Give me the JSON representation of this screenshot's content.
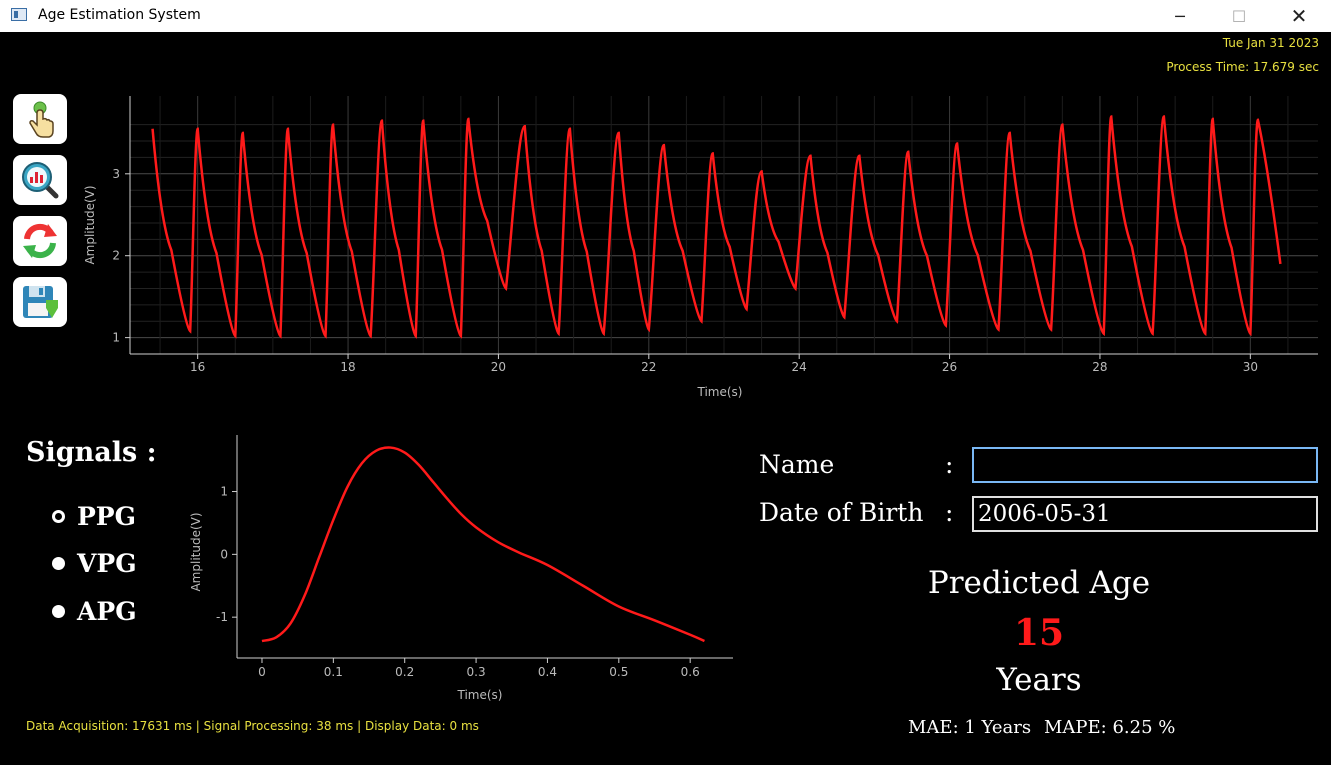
{
  "window": {
    "title": "Age Estimation System",
    "minimize": "─",
    "maximize": "☐",
    "close": "✕"
  },
  "header": {
    "date": "Tue Jan 31 2023",
    "process_time": "Process Time: 17.679 sec"
  },
  "toolbar": [
    {
      "icon": "finger-touch-icon"
    },
    {
      "icon": "analysis-magnifier-icon"
    },
    {
      "icon": "refresh-icon"
    },
    {
      "icon": "save-disk-icon"
    }
  ],
  "signals": {
    "title": "Signals :",
    "options": [
      "PPG",
      "VPG",
      "APG"
    ],
    "selected": "PPG"
  },
  "form": {
    "name_label": "Name",
    "name_colon": ":",
    "name_value": "",
    "dob_label": "Date of Birth",
    "dob_colon": ":",
    "dob_value": "2006-05-31"
  },
  "prediction": {
    "title": "Predicted Age",
    "value": "15",
    "unit": "Years"
  },
  "metrics": {
    "mae": "MAE: 1 Years",
    "mape": "MAPE: 6.25 %"
  },
  "status": "Data Acquisition: 17631 ms | Signal Processing: 38 ms | Display Data: 0 ms",
  "colors": {
    "signal": "#ff1a1a",
    "status_text": "#e8e040",
    "background": "#000000"
  },
  "chart_data": [
    {
      "type": "line",
      "xlabel": "Time(s)",
      "ylabel": "Amplitude(V)",
      "xlim": [
        15.1,
        30.9
      ],
      "ylim": [
        0.8,
        3.95
      ],
      "xticks": [
        "16",
        "18",
        "20",
        "22",
        "24",
        "26",
        "28",
        "30"
      ],
      "yticks": [
        "1",
        "2",
        "3"
      ],
      "grid": true,
      "series": [
        {
          "start": {
            "x": 15.4,
            "y": 3.55
          },
          "cycles": [
            {
              "trough": 15.9,
              "y_trough": 1.08,
              "peak": 16.0,
              "y_peak": 3.55
            },
            {
              "trough": 16.5,
              "y_trough": 1.02,
              "peak": 16.6,
              "y_peak": 3.5
            },
            {
              "trough": 17.1,
              "y_trough": 1.02,
              "peak": 17.2,
              "y_peak": 3.55
            },
            {
              "trough": 17.7,
              "y_trough": 1.02,
              "peak": 17.8,
              "y_peak": 3.6
            },
            {
              "trough": 18.3,
              "y_trough": 1.02,
              "peak": 18.45,
              "y_peak": 3.65
            },
            {
              "trough": 18.9,
              "y_trough": 1.02,
              "peak": 19.0,
              "y_peak": 3.65
            },
            {
              "trough": 19.5,
              "y_trough": 1.02,
              "peak": 19.6,
              "y_peak": 3.67
            },
            {
              "trough": 20.1,
              "y_trough": 1.6,
              "peak": 20.35,
              "y_peak": 3.58
            },
            {
              "trough": 20.8,
              "y_trough": 1.05,
              "peak": 20.95,
              "y_peak": 3.55
            },
            {
              "trough": 21.4,
              "y_trough": 1.05,
              "peak": 21.6,
              "y_peak": 3.5
            },
            {
              "trough": 22.0,
              "y_trough": 1.1,
              "peak": 22.2,
              "y_peak": 3.35
            },
            {
              "trough": 22.7,
              "y_trough": 1.2,
              "peak": 22.85,
              "y_peak": 3.25
            },
            {
              "trough": 23.3,
              "y_trough": 1.35,
              "peak": 23.5,
              "y_peak": 3.03
            },
            {
              "trough": 23.95,
              "y_trough": 1.6,
              "peak": 24.15,
              "y_peak": 3.22
            },
            {
              "trough": 24.6,
              "y_trough": 1.25,
              "peak": 24.8,
              "y_peak": 3.22
            },
            {
              "trough": 25.3,
              "y_trough": 1.2,
              "peak": 25.45,
              "y_peak": 3.27
            },
            {
              "trough": 25.95,
              "y_trough": 1.15,
              "peak": 26.1,
              "y_peak": 3.37
            },
            {
              "trough": 26.65,
              "y_trough": 1.1,
              "peak": 26.8,
              "y_peak": 3.5
            },
            {
              "trough": 27.35,
              "y_trough": 1.1,
              "peak": 27.5,
              "y_peak": 3.6
            },
            {
              "trough": 28.05,
              "y_trough": 1.05,
              "peak": 28.15,
              "y_peak": 3.7
            },
            {
              "trough": 28.7,
              "y_trough": 1.05,
              "peak": 28.85,
              "y_peak": 3.7
            },
            {
              "trough": 29.4,
              "y_trough": 1.05,
              "peak": 29.5,
              "y_peak": 3.67
            },
            {
              "trough": 30.0,
              "y_trough": 1.05,
              "peak": 30.1,
              "y_peak": 3.66
            }
          ],
          "end": {
            "x": 30.4,
            "y": 1.9
          }
        }
      ]
    },
    {
      "type": "line",
      "xlabel": "Time(s)",
      "ylabel": "Amplitude(V)",
      "xlim": [
        -0.035,
        0.66
      ],
      "ylim": [
        -1.65,
        1.9
      ],
      "xticks": [
        "0",
        "0.1",
        "0.2",
        "0.3",
        "0.4",
        "0.5",
        "0.6"
      ],
      "yticks": [
        "-1",
        "0",
        "1"
      ],
      "grid": false,
      "series": [
        {
          "x": [
            0.0,
            0.02,
            0.04,
            0.06,
            0.08,
            0.1,
            0.12,
            0.14,
            0.16,
            0.18,
            0.2,
            0.22,
            0.24,
            0.26,
            0.28,
            0.3,
            0.33,
            0.36,
            0.4,
            0.45,
            0.5,
            0.55,
            0.6,
            0.62
          ],
          "y": [
            -1.38,
            -1.32,
            -1.1,
            -0.65,
            -0.05,
            0.55,
            1.08,
            1.45,
            1.65,
            1.7,
            1.62,
            1.42,
            1.15,
            0.88,
            0.63,
            0.43,
            0.2,
            0.03,
            -0.17,
            -0.5,
            -0.83,
            -1.05,
            -1.28,
            -1.38
          ]
        }
      ]
    }
  ]
}
